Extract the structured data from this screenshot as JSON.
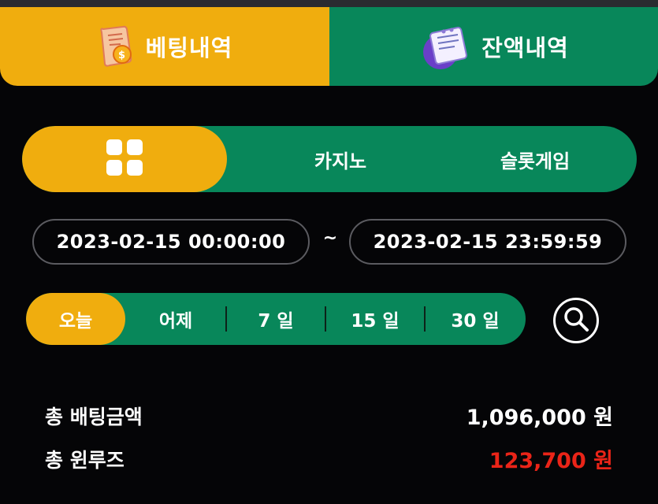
{
  "tabs": {
    "betting_history": "베팅내역",
    "balance_history": "잔액내역"
  },
  "categories": {
    "all_icon": "grid-icon",
    "casino": "카지노",
    "slot": "슬롯게임"
  },
  "date_range": {
    "start": "2023-02-15 00:00:00",
    "separator": "~",
    "end": "2023-02-15 23:59:59"
  },
  "periods": [
    "오늘",
    "어제",
    "7 일",
    "15 일",
    "30 일"
  ],
  "summary": {
    "total_bet_label": "총 배팅금액",
    "total_bet_value": "1,096,000 원",
    "total_winloss_label": "총 윈루즈",
    "total_winloss_value": "123,700 원"
  },
  "colors": {
    "accent_yellow": "#f0ad0e",
    "accent_green": "#08875a",
    "loss_red": "#ea2418",
    "background": "#050507"
  }
}
